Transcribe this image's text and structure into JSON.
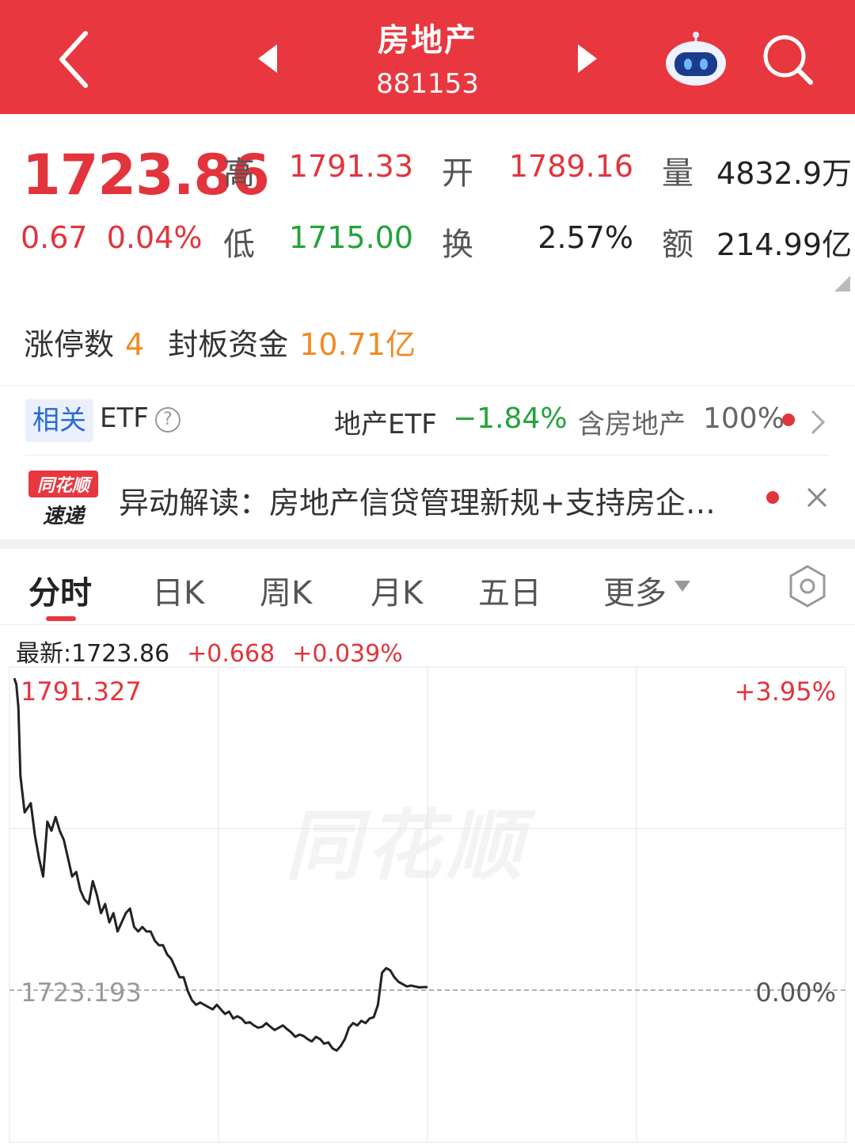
{
  "header": {
    "title": "房地产",
    "code": "881153"
  },
  "quote": {
    "price": "1723.86",
    "change": "0.67",
    "change_pct": "0.04%",
    "high_label": "高",
    "high": "1791.33",
    "open_label": "开",
    "open": "1789.16",
    "volume_label": "量",
    "volume": "4832.9万",
    "low_label": "低",
    "low": "1715.00",
    "turnover_label": "换",
    "turnover": "2.57%",
    "amount_label": "额",
    "amount": "214.99亿"
  },
  "limit_up": {
    "count_label": "涨停数",
    "count": "4",
    "fund_label": "封板资金",
    "fund": "10.71亿"
  },
  "etf": {
    "tag": "相关",
    "label": "ETF",
    "help": "?",
    "name": "地产ETF",
    "change": "−1.84%",
    "contains_label": "含房地产",
    "ratio": "100%"
  },
  "news": {
    "logo_top": "同花顺",
    "logo_bottom": "速递",
    "text": "异动解读：房地产信贷管理新规+支持房企…"
  },
  "tabs": [
    {
      "label": "分时"
    },
    {
      "label": "日K"
    },
    {
      "label": "周K"
    },
    {
      "label": "月K"
    },
    {
      "label": "五日"
    },
    {
      "label": "更多"
    }
  ],
  "stats": {
    "latest": "最新:1723.86",
    "change": "+0.668",
    "change_pct": "+0.039%"
  },
  "chart_data": {
    "type": "line",
    "y_top_label": "1791.327",
    "y_top_pct": "+3.95%",
    "y_base_label": "1723.193",
    "y_base_pct": "0.00%",
    "watermark": "同花顺",
    "ylim": [
      1723.193,
      1791.327
    ],
    "x": [
      0,
      1,
      2,
      3,
      5,
      8,
      10,
      12,
      14,
      16,
      18,
      20,
      22,
      24,
      26,
      28,
      30,
      32,
      34,
      36,
      38,
      40,
      42,
      44,
      46,
      48,
      50,
      52,
      54,
      56,
      58,
      60,
      62,
      64,
      66,
      68,
      70,
      72,
      74,
      76,
      78,
      80,
      82,
      84,
      86,
      88,
      90,
      92,
      94,
      96,
      98,
      100,
      102,
      104,
      106,
      108,
      110,
      112,
      114,
      116,
      118,
      120,
      122,
      124,
      126,
      128,
      130,
      132,
      134,
      136,
      138,
      140,
      142,
      144,
      146,
      148,
      150,
      152,
      154,
      156,
      158,
      160,
      162,
      164,
      166,
      168,
      170,
      172,
      174,
      176,
      178,
      180,
      182,
      184,
      186,
      188,
      190,
      192,
      194,
      196,
      198,
      200
    ],
    "values": [
      1791.3,
      1790.0,
      1785.0,
      1770.0,
      1762.0,
      1764.0,
      1757.0,
      1752.0,
      1748.0,
      1760.0,
      1758.0,
      1761.0,
      1758.0,
      1756.0,
      1752.0,
      1748.0,
      1749.0,
      1745.0,
      1743.0,
      1742.0,
      1747.0,
      1744.0,
      1740.0,
      1742.0,
      1738.0,
      1740.0,
      1736.0,
      1738.0,
      1740.0,
      1741.0,
      1737.0,
      1736.0,
      1737.0,
      1736.0,
      1736.0,
      1734.0,
      1733.0,
      1733.0,
      1731.0,
      1730.0,
      1728.0,
      1726.0,
      1726.0,
      1723.0,
      1721.0,
      1720.0,
      1720.5,
      1720.0,
      1719.5,
      1719.0,
      1720.0,
      1719.0,
      1718.0,
      1718.5,
      1717.0,
      1717.5,
      1717.0,
      1716.0,
      1716.2,
      1715.5,
      1715.0,
      1715.2,
      1716.0,
      1715.2,
      1714.5,
      1715.0,
      1715.5,
      1714.7,
      1714.0,
      1713.0,
      1713.5,
      1713.2,
      1712.5,
      1712.0,
      1713.0,
      1712.5,
      1711.5,
      1711.8,
      1710.5,
      1710.0,
      1711.0,
      1712.5,
      1715.0,
      1716.0,
      1715.5,
      1716.5,
      1716.0,
      1717.0,
      1717.3,
      1720.0,
      1727.0,
      1728.0,
      1727.5,
      1726.0,
      1725.0,
      1724.5,
      1724.0,
      1724.2,
      1724.0,
      1723.8,
      1723.86,
      1723.86
    ]
  },
  "colors": {
    "header_bg": "#e8373f",
    "up": "#e2343c",
    "down": "#22a33a",
    "amount": "#f08a24",
    "accent_blue": "#2c6bd1"
  },
  "icons": [
    "back-arrow-icon",
    "prev-triangle-icon",
    "next-triangle-icon",
    "robot-assistant-icon",
    "search-icon",
    "help-circle-icon",
    "chevron-right-icon",
    "close-icon",
    "dropdown-triangle-icon",
    "settings-hexagon-icon"
  ]
}
